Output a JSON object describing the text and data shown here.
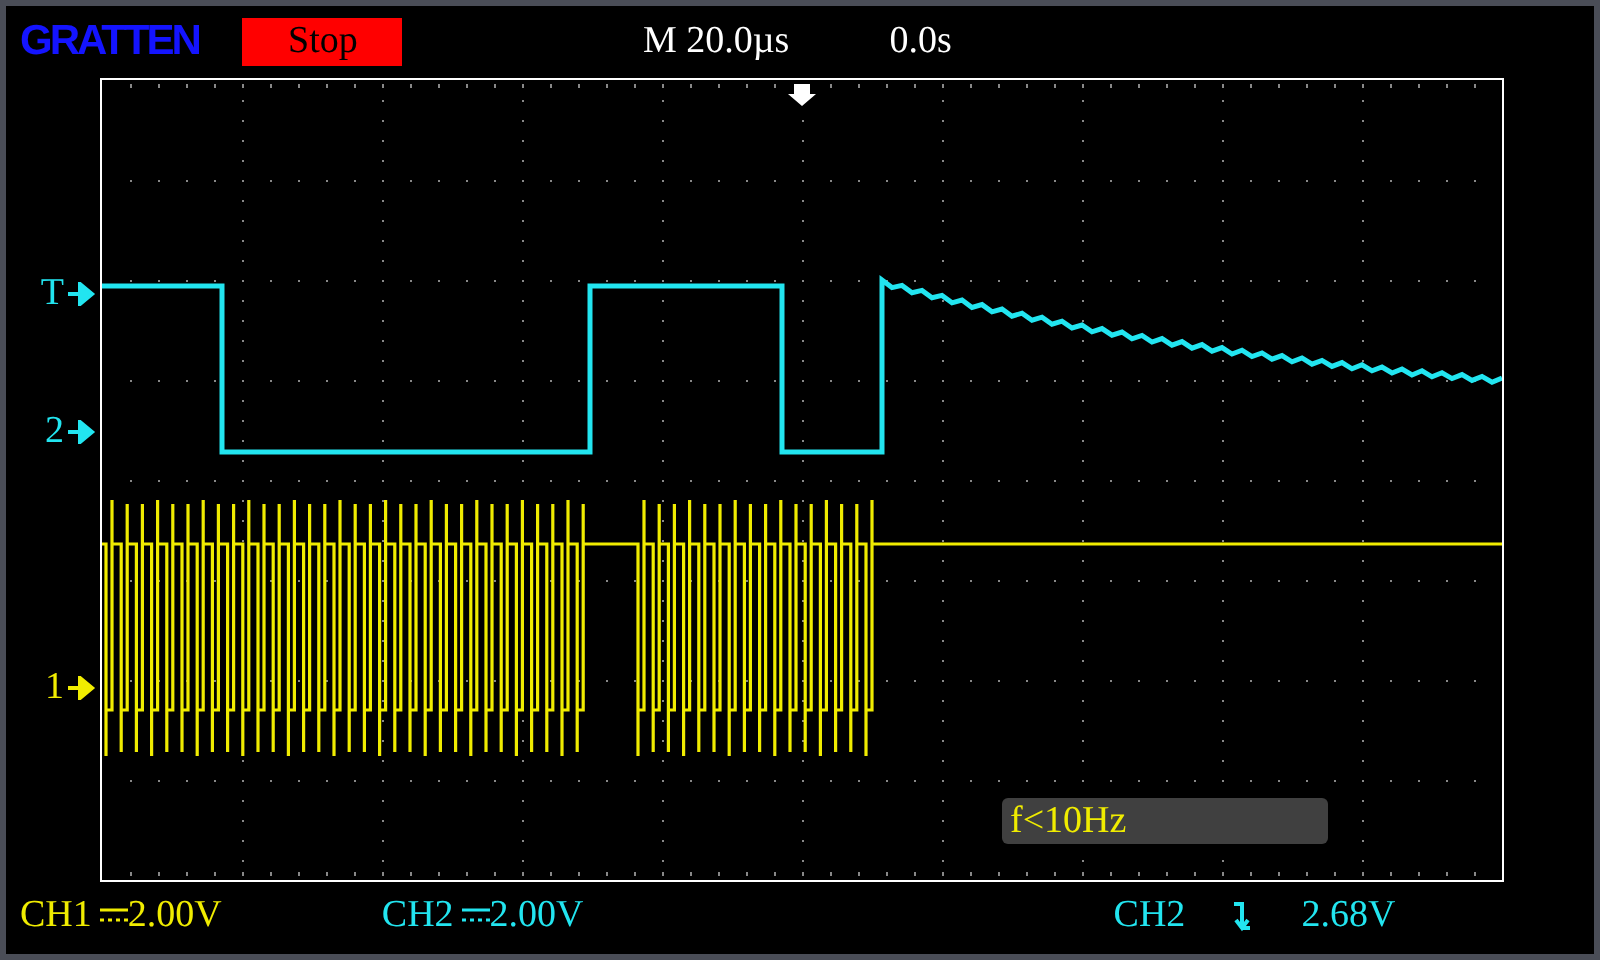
{
  "header": {
    "logo": "GRATTEN",
    "run_state": "Stop",
    "timebase": "M 20.0µs",
    "trigger_position": "0.0s"
  },
  "markers": [
    {
      "label": "T",
      "kind": "trigger",
      "color": "#22e5f0"
    },
    {
      "label": "2",
      "kind": "channel",
      "color": "#22e5f0"
    },
    {
      "label": "1",
      "kind": "channel",
      "color": "#f0ec00"
    }
  ],
  "frequency": "f<10Hz",
  "footer": {
    "channels": [
      {
        "name": "CH1",
        "coupling": {
          "kind": "dc"
        },
        "volts_per_div": "2.00V",
        "color": "#f0ec00"
      },
      {
        "name": "CH2",
        "coupling": {
          "kind": "dc"
        },
        "volts_per_div": "2.00V",
        "color": "#22e5f0"
      }
    ],
    "trigger": {
      "source": "CH2",
      "slope": {
        "kind": "falling"
      },
      "level": "2.68V"
    }
  }
}
